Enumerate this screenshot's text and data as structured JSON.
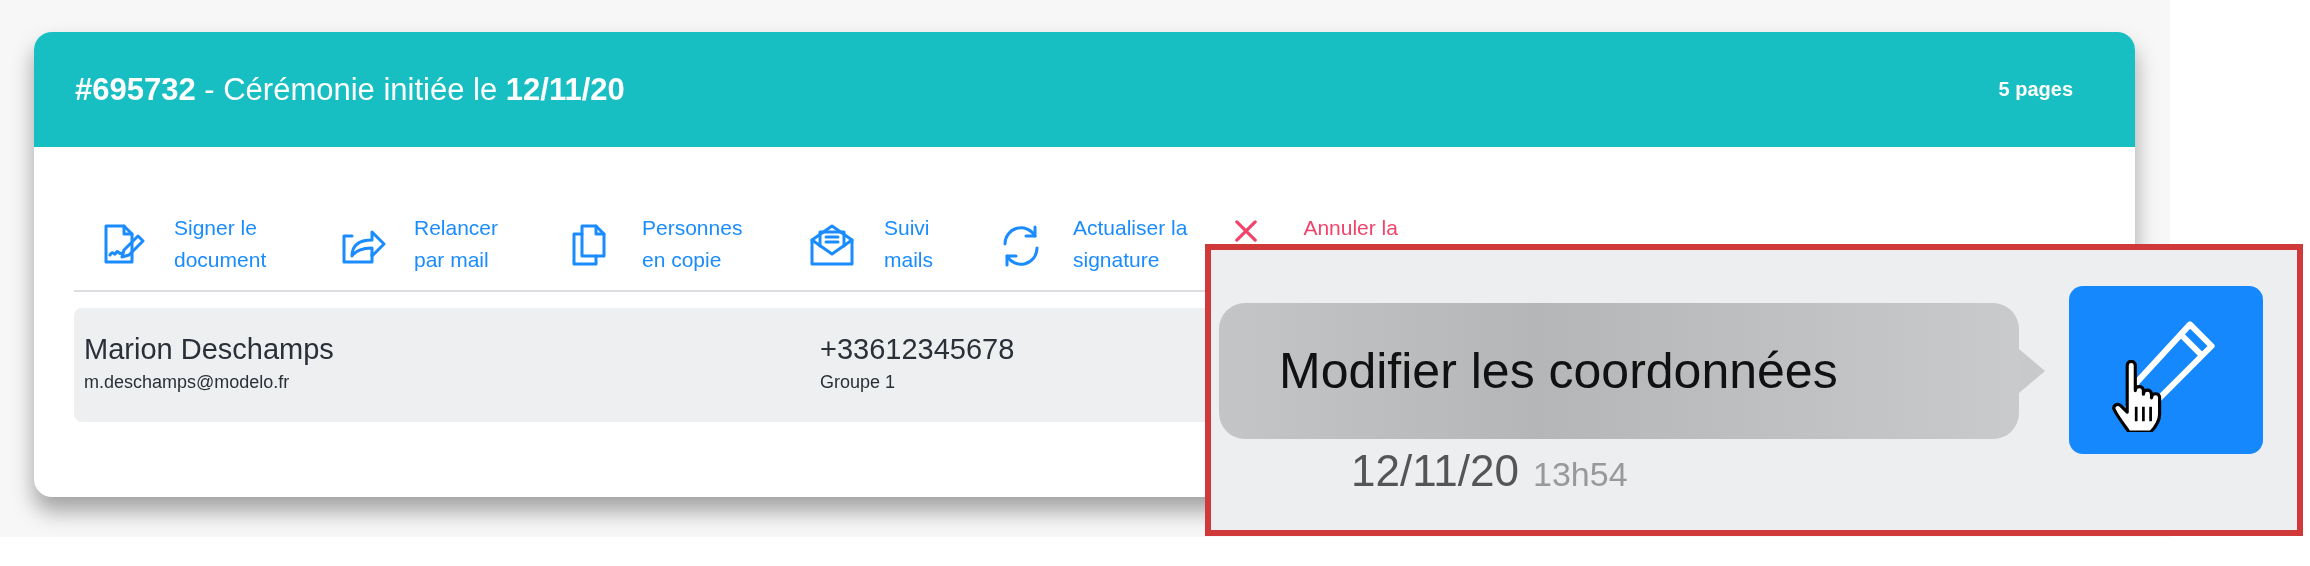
{
  "header": {
    "title": "**#695732** - Cérémonie initiée le **12/11/20**",
    "pages": "5 pages"
  },
  "actions": [
    {
      "kind": "sign",
      "lines": [
        "Signer le",
        "document"
      ]
    },
    {
      "kind": "resend",
      "lines": [
        "Relancer",
        "par mail"
      ]
    },
    {
      "kind": "copy",
      "lines": [
        "Personnes",
        "en copie"
      ]
    },
    {
      "kind": "mail",
      "lines": [
        "Suivi",
        "mails"
      ]
    },
    {
      "kind": "refresh",
      "lines": [
        "Actualiser la",
        "signature"
      ]
    },
    {
      "kind": "cancel",
      "lines": [
        "Annuler la"
      ]
    }
  ],
  "signer": {
    "name": "Marion Deschamps",
    "email": "m.deschamps@modelo.fr",
    "phone": "+33612345678",
    "group": "Groupe 1"
  },
  "zoom_inset": {
    "date": "12/11/20",
    "time": "13h54",
    "tooltip": "Modifier les coordonnées"
  }
}
